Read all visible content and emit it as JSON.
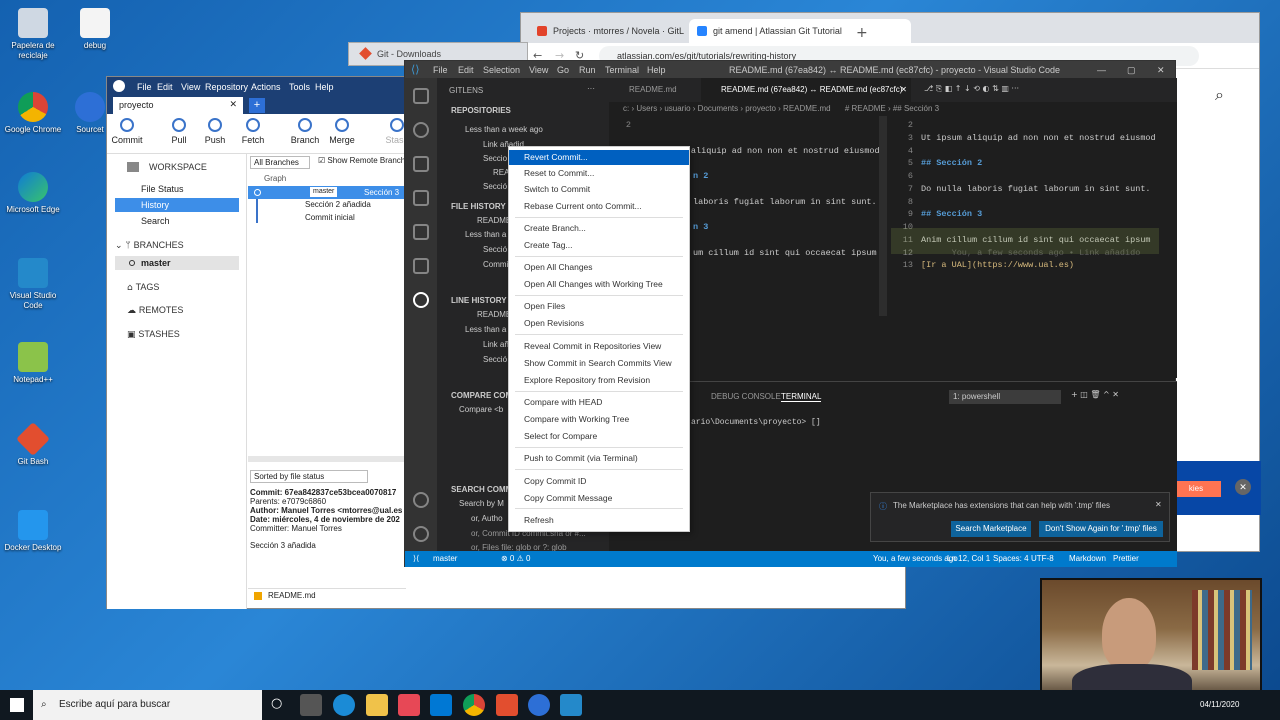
{
  "desktop": {
    "icons": [
      {
        "label": "Papelera de reciclaje"
      },
      {
        "label": "debug"
      },
      {
        "label": "Google Chrome"
      },
      {
        "label": "Sourcet"
      },
      {
        "label": "Microsoft Edge"
      },
      {
        "label": "Visual Studio Code"
      },
      {
        "label": "Notepad++"
      },
      {
        "label": "Git Bash"
      },
      {
        "label": "Docker Desktop"
      }
    ]
  },
  "taskbar": {
    "search_placeholder": "Escribe aquí para buscar",
    "date": "04/11/2020"
  },
  "browser": {
    "tab1": "Projects · mtorres / Novela · GitL",
    "tab2": "git amend | Atlassian Git Tutorial",
    "url": "atlassian.com/es/git/tutorials/rewriting-history",
    "tab_downloads": "Git - Downloads",
    "cookies_btn": "kies"
  },
  "sourcetree": {
    "tab": "proyecto",
    "menu": [
      "File",
      "Edit",
      "View",
      "Repository",
      "Actions",
      "Tools",
      "Help"
    ],
    "toolbar": [
      "Commit",
      "Pull",
      "Push",
      "Fetch",
      "Branch",
      "Merge",
      "Stash"
    ],
    "workspace": "WORKSPACE",
    "workspace_items": [
      "File Status",
      "History",
      "Search"
    ],
    "branches": "BRANCHES",
    "branch_master": "master",
    "tags": "TAGS",
    "remotes": "REMOTES",
    "stashes": "STASHES",
    "all_branches": "All Branches",
    "show_remote": "Show Remote Branch",
    "graph_col": "Graph",
    "commits": [
      {
        "branch": "master",
        "desc": "Sección 3"
      },
      {
        "desc": "Sección 2 añadida"
      },
      {
        "desc": "Commit inicial"
      }
    ],
    "sorted_by": "Sorted by file status",
    "detail": {
      "commit": "Commit: 67ea842837ce53bcea0070817",
      "parents": "Parents: e7079c6860",
      "author": "Author: Manuel Torres <mtorres@ual.es",
      "date": "Date: miércoles, 4 de noviembre de 202",
      "committer": "Committer: Manuel Torres",
      "message": "Sección 3 añadida"
    },
    "file": "README.md"
  },
  "vscode": {
    "title": "README.md (67ea842) ↔ README.md (ec87cfc) - proyecto - Visual Studio Code",
    "menu": [
      "File",
      "Edit",
      "Selection",
      "View",
      "Go",
      "Run",
      "Terminal",
      "Help"
    ],
    "side_title": "GITLENS",
    "side": {
      "repositories": "REPOSITORIES",
      "less_than_week": "Less than a week ago",
      "link_anad": "Link añadid",
      "seccio": "Seccio",
      "read": "READ",
      "seccio2": "Secció",
      "file_history": "FILE HISTORY",
      "readme": "README",
      "less_than": "Less than a",
      "seccion": "Secció",
      "commi": "Commi",
      "line_history": "LINE HISTORY",
      "readme2": "README",
      "less_than2": "Less than a",
      "link_an": "Link añ",
      "seccion2": "Secció",
      "compare": "COMPARE COMMI",
      "compare_row": "Compare <b",
      "search_commits": "SEARCH COMMI",
      "search_by": "Search by M",
      "or_author": "or, Autho",
      "or_commit": "or, Commit ID  commit:sha or #...",
      "or_files": "or, Files  file: glob or ?: glob"
    },
    "editor_tab1": "README.md",
    "editor_tab2": "README.md (67ea842) ↔ README.md (ec87cfc)",
    "crumbs_left": "c: › Users › usuario › Documents › proyecto › README.md",
    "crumbs_right": "# README › ## Sección 3",
    "left_code": [
      {
        "n": "2",
        "t": ""
      },
      {
        "n": "3",
        "t": "Ut ipsum aliquip ad non non et nostrud eiusmod"
      },
      {
        "n": "",
        "t": "n 2"
      },
      {
        "n": "",
        "t": "laboris fugiat laborum in sint sunt."
      },
      {
        "n": "",
        "t": "n 3"
      },
      {
        "n": "",
        "t": "um cillum id sint qui occaecat ipsum"
      }
    ],
    "right_code": [
      {
        "n": "2",
        "t": "",
        "cls": ""
      },
      {
        "n": "3",
        "t": "Ut ipsum aliquip ad non non et nostrud eiusmod",
        "cls": ""
      },
      {
        "n": "4",
        "t": "",
        "cls": ""
      },
      {
        "n": "5",
        "t": "## Sección 2",
        "cls": "hd"
      },
      {
        "n": "6",
        "t": "",
        "cls": ""
      },
      {
        "n": "7",
        "t": "Do nulla laboris fugiat laborum in sint sunt.",
        "cls": ""
      },
      {
        "n": "8",
        "t": "",
        "cls": ""
      },
      {
        "n": "9",
        "t": "## Sección 3",
        "cls": "hd"
      },
      {
        "n": "10",
        "t": "",
        "cls": ""
      },
      {
        "n": "11",
        "t": "Anim cillum cillum id sint qui occaecat ipsum",
        "cls": ""
      },
      {
        "n": "12",
        "t": "      You, a few seconds ago • Link añadido",
        "cls": "ghost"
      },
      {
        "n": "13",
        "t": "[Ir a UAL](https://www.ual.es)",
        "cls": "lnk"
      }
    ],
    "panel_tabs": [
      "DEBUG CONSOLE",
      "TERMINAL"
    ],
    "terminal_select": "1: powershell",
    "terminal_line": "ario\\Documents\\proyecto> []",
    "status": {
      "branch": "master",
      "sync": "⊗ 0 ⚠ 0",
      "blame": "You, a few seconds ago",
      "pos": "Ln 12, Col 1",
      "spaces": "Spaces: 4",
      "enc": "UTF-8",
      "lang": "Markdown",
      "prettier": "Prettier"
    },
    "notif": {
      "text": "The Marketplace has extensions that can help with '.tmp' files",
      "btn1": "Search Marketplace",
      "btn2": "Don't Show Again for '.tmp' files"
    }
  },
  "context_menu": {
    "items": [
      "Revert Commit...",
      "Reset to Commit...",
      "Switch to Commit",
      "Rebase Current onto Commit...",
      "Create Branch...",
      "Create Tag...",
      "Open All Changes",
      "Open All Changes with Working Tree",
      "Open Files",
      "Open Revisions",
      "Reveal Commit in Repositories View",
      "Show Commit in Search Commits View",
      "Explore Repository from Revision",
      "Compare with HEAD",
      "Compare with Working Tree",
      "Select for Compare",
      "Push to Commit (via Terminal)",
      "Copy Commit ID",
      "Copy Commit Message",
      "Refresh"
    ]
  },
  "colors": {
    "vscode_blue": "#007acc",
    "sourcetree_blue": "#1c3f74",
    "menu_highlight": "#0060c0"
  }
}
